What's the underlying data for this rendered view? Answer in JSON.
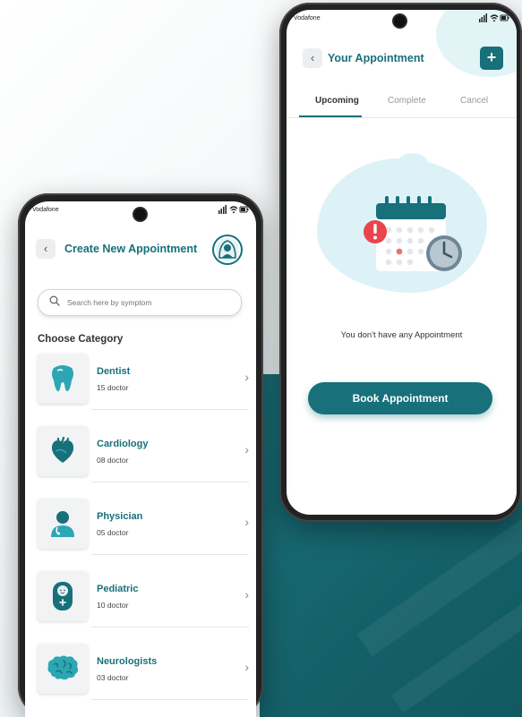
{
  "colors": {
    "accent": "#17707a",
    "light_blob": "#ddf2f7"
  },
  "right_phone": {
    "carrier": "Vodafone",
    "status_icons": "signal-icon wifi-icon battery-icon",
    "header": {
      "back_icon": "chevron-left-icon",
      "title": "Your Appointment",
      "add_icon": "plus-icon"
    },
    "tabs": [
      {
        "label": "Upcoming",
        "active": true
      },
      {
        "label": "Complete",
        "active": false
      },
      {
        "label": "Cancel",
        "active": false
      }
    ],
    "empty_state": {
      "illustration": "calendar-clock-alert-icon",
      "message": "You don't have any Appointment"
    },
    "book_button": "Book Appointment"
  },
  "left_phone": {
    "carrier": "Vodafone",
    "header": {
      "back_icon": "chevron-left-icon",
      "title": "Create New Appointment",
      "avatar_icon": "doctor-avatar-icon"
    },
    "search": {
      "placeholder": "Search here by symptom",
      "value": ""
    },
    "section_title": "Choose Category",
    "categories": [
      {
        "name": "Dentist",
        "count": "15 doctor",
        "icon": "tooth-icon"
      },
      {
        "name": "Cardiology",
        "count": "08 doctor",
        "icon": "heart-icon"
      },
      {
        "name": "Physician",
        "count": "05 doctor",
        "icon": "doctor-icon"
      },
      {
        "name": "Pediatric",
        "count": "10 doctor",
        "icon": "baby-icon"
      },
      {
        "name": "Neurologists",
        "count": "03 doctor",
        "icon": "brain-icon"
      }
    ]
  }
}
